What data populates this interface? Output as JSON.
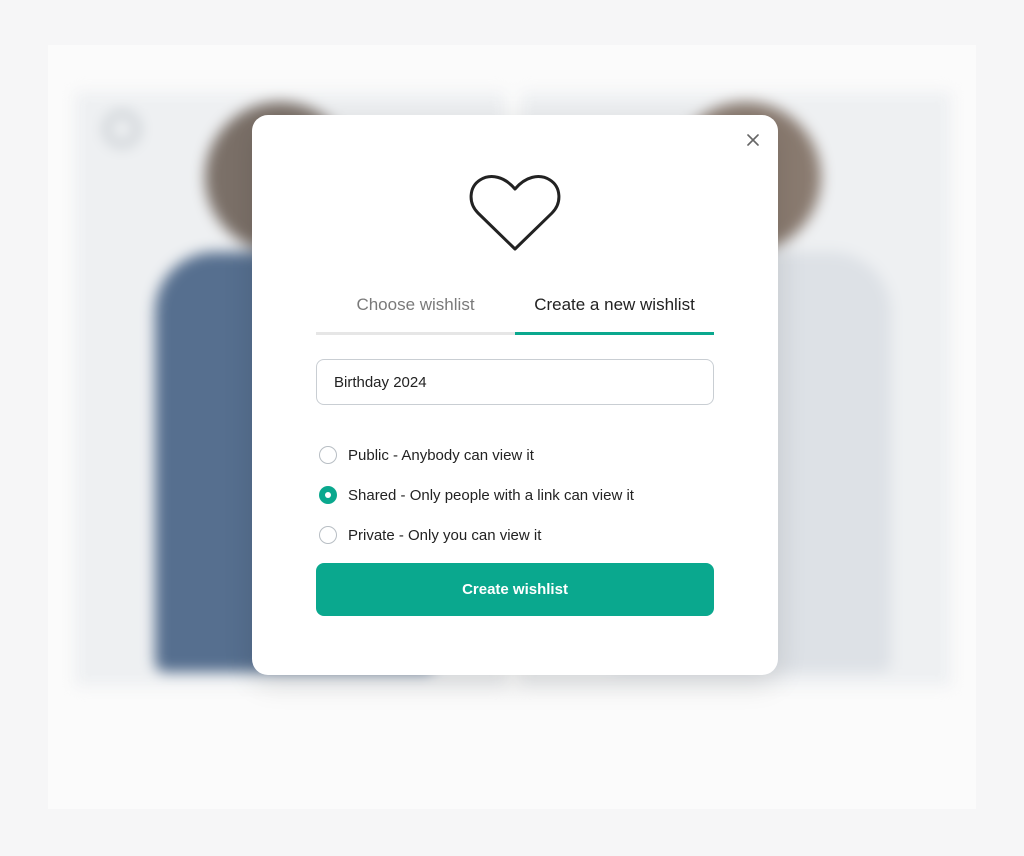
{
  "modal": {
    "tabs": [
      {
        "label": "Choose wishlist",
        "active": false
      },
      {
        "label": "Create a new wishlist",
        "active": true
      }
    ],
    "name_input": {
      "value": "Birthday 2024"
    },
    "privacy_options": [
      {
        "label": "Public - Anybody can view it",
        "checked": false
      },
      {
        "label": "Shared - Only people with a link can view it",
        "checked": true
      },
      {
        "label": "Private - Only you can view it",
        "checked": false
      }
    ],
    "submit_label": "Create wishlist",
    "icons": {
      "close": "close-icon",
      "heart": "heart-icon"
    }
  },
  "colors": {
    "accent": "#0aa88e",
    "page_background": "#f6f6f7",
    "modal_background": "#ffffff"
  }
}
